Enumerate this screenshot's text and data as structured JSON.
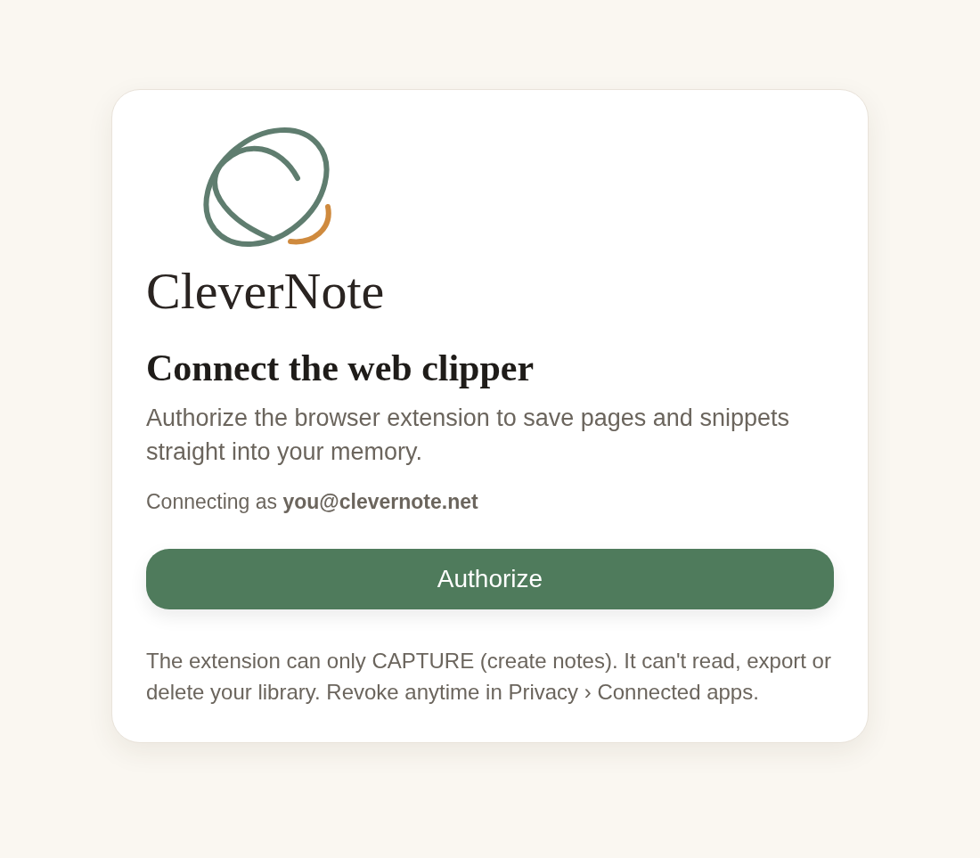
{
  "logo": {
    "wordmark": "CleverNote"
  },
  "heading": "Connect the web clipper",
  "description": "Authorize the browser extension to save pages and snippets straight into your memory.",
  "account_line": "Connecting as **you@clevernote.net**",
  "button": {
    "label": "Authorize"
  },
  "footnote": "The extension can only CAPTURE (create notes). It can't read, export or delete your library. Revoke anytime in Privacy › Connected apps."
}
